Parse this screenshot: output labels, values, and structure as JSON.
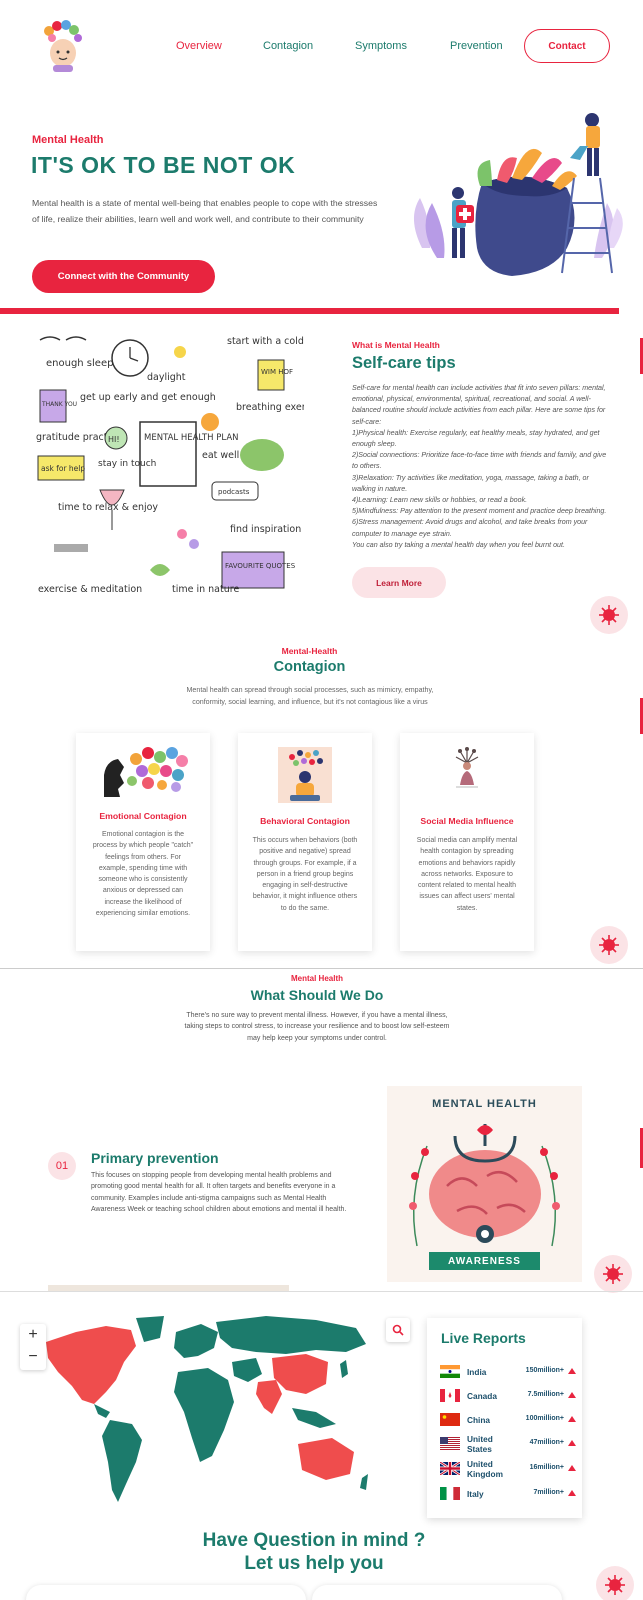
{
  "nav": {
    "items": [
      "Overview",
      "Contagion",
      "Symptoms",
      "Prevention"
    ],
    "contact": "Contact"
  },
  "hero": {
    "eyebrow": "Mental Health",
    "title": "IT'S OK TO BE NOT OK",
    "description": "Mental health is a state of mental well-being that enables people to cope with the stresses of life, realize their abilities, learn well and work well, and contribute to their community",
    "cta": "Connect with the Community"
  },
  "selfcare": {
    "eyebrow": "What is Mental Health",
    "title": "Self-care tips",
    "body": "Self-care for mental health can include activities that fit into seven pillars: mental, emotional, physical, environmental, spiritual, recreational, and social. A well-balanced routine should include activities from each pillar. Here are some tips for self-care:\n1)Physical health: Exercise regularly, eat healthy meals, stay hydrated, and get enough sleep.\n2)Social connections: Prioritize face-to-face time with friends and family, and give to others.\n3)Relaxation: Try activities like meditation, yoga, massage, taking a bath, or walking in nature.\n4)Learning: Learn new skills or hobbies, or read a book.\n5)Mindfulness: Pay attention to the present moment and practice deep breathing.\n6)Stress management: Avoid drugs and alcohol, and take breaks from your computer to manage eye strain.\nYou can also try taking a mental health day when you feel burnt out.",
    "button": "Learn More",
    "doodles": {
      "sleep": "enough sleep",
      "daylight": "daylight",
      "shower": "start with a cold shower",
      "wimhof": "WIM HOF",
      "thankyou": "THANK YOU",
      "early": "get up early and get enough",
      "breathing": "breathing exercises",
      "gratitude": "gratitude practice",
      "hi": "HI!",
      "touch": "stay in touch",
      "plan": "MENTAL HEALTH PLAN",
      "eatwell": "eat well",
      "askhelp": "ask for help",
      "podcasts": "podcasts",
      "relax": "time to relax & enjoy",
      "inspiration": "find inspiration",
      "quotes": "FAVOURITE QUOTES",
      "meditation": "exercise & meditation",
      "nature": "time in nature"
    }
  },
  "contagion": {
    "eyebrow": "Mental-Health",
    "title": "Contagion",
    "description": "Mental health can spread through social processes, such as mimicry, empathy, conformity, social learning, and influence, but it's not contagious like a virus",
    "cards": [
      {
        "title": "Emotional Contagion",
        "body": "Emotional contagion is the process by which people \"catch\" feelings from others. For example, spending time with someone who is consistently anxious or depressed can increase the likelihood of experiencing similar emotions."
      },
      {
        "title": "Behavioral Contagion",
        "body": "This occurs when behaviors (both positive and negative) spread through groups. For example, if a person in a friend group begins engaging in self-destructive behavior, it might influence others to do the same."
      },
      {
        "title": "Social Media Influence",
        "body": "Social media can amplify mental health contagion by spreading emotions and behaviors rapidly across networks. Exposure to content related to mental health issues can affect users' mental states."
      }
    ]
  },
  "whatdo": {
    "eyebrow": "Mental Health",
    "title": "What Should We Do",
    "description": "There's no sure way to prevent mental illness. However, if you have a mental illness, taking steps to control stress, to increase your resilience and to boost low self-esteem may help keep your symptoms under control."
  },
  "prevention": {
    "number": "01",
    "title": "Primary prevention",
    "body": "This focuses on stopping people from developing mental health problems and promoting good mental health for all. It often targets and benefits everyone in a community. Examples include anti-stigma campaigns such as Mental Health Awareness Week or teaching school children about emotions and mental ill health.",
    "poster_title": "MENTAL HEALTH",
    "poster_ribbon": "AWARENESS"
  },
  "map": {
    "zoom_in": "+",
    "zoom_out": "−"
  },
  "reports": {
    "title": "Live Reports",
    "rows": [
      {
        "country": "India",
        "value": "150million+",
        "flag": "india-flag-icon"
      },
      {
        "country": "Canada",
        "value": "7.5million+",
        "flag": "canada-flag-icon"
      },
      {
        "country": "China",
        "value": "100million+",
        "flag": "china-flag-icon"
      },
      {
        "country": "United States",
        "value": "47million+",
        "flag": "us-flag-icon"
      },
      {
        "country": "United Kingdom",
        "value": "16million+",
        "flag": "uk-flag-icon"
      },
      {
        "country": "Italy",
        "value": "7million+",
        "flag": "italy-flag-icon"
      }
    ]
  },
  "question": {
    "line1": "Have Question in mind ?",
    "line2": "Let us help you"
  },
  "colors": {
    "accent": "#e8243f",
    "brand": "#1c7b6c",
    "soft": "#fbe3e6"
  }
}
